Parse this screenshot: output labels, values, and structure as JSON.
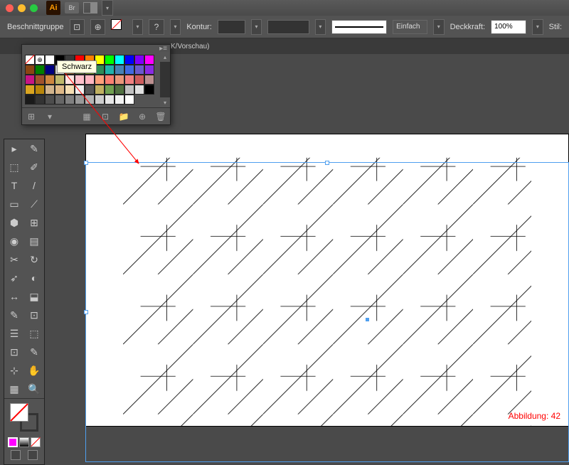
{
  "app": {
    "short": "Ai",
    "bridge": "Br"
  },
  "controlbar": {
    "object_type": "Beschnittgruppe",
    "stroke_label": "Kontur:",
    "stroke_style": "Einfach",
    "opacity_label": "Deckkraft:",
    "opacity_value": "100%",
    "style_label": "Stil:"
  },
  "tab": {
    "suffix": "K/Vorschau)"
  },
  "swatches": {
    "tooltip": "Schwarz",
    "rows": [
      [
        "#ffffff",
        "#000000",
        "#3a3a3a",
        "#ff0000",
        "#ff7f00",
        "#ffff00",
        "#00ff00",
        "#00ffff",
        "#0000ff",
        "#7f00ff",
        "#ff00ff",
        "#8b4513",
        "#008000",
        "#000080"
      ],
      [
        "#d0d0d0",
        "#8b5a2b",
        "#556b2f",
        "#6b8e23",
        "#2e8b57",
        "#20b2aa",
        "#4682b4",
        "#4169e1",
        "#6a5acd",
        "#8a2be2",
        "#c71585",
        "#a0522d",
        "#cd853f",
        "#bdb76b"
      ],
      [
        "#ffe4e1",
        "#ffc0cb",
        "#ffb6c1",
        "#ffa07a",
        "#fa8072",
        "#e9967a",
        "#f08080",
        "#cd5c5c",
        "#bc8f8f",
        "#daa520",
        "#b8860b",
        "#d2b48c",
        "#deb887",
        "#f5deb3"
      ],
      [
        "#eeeeee",
        "#555555",
        "#c0b060",
        "#70a050",
        "#507040",
        "#c0c0c0",
        "#e0e0e0"
      ],
      [
        "#000000",
        "#1a1a1a",
        "#333333",
        "#4d4d4d",
        "#666666",
        "#808080",
        "#999999",
        "#b3b3b3",
        "#cccccc",
        "#e6e6e6",
        "#f2f2f2",
        "#ffffff"
      ]
    ]
  },
  "caption": "Abbildung: 42",
  "tools": [
    [
      "▸",
      "✎"
    ],
    [
      "⬚",
      "✐"
    ],
    [
      "T",
      "/"
    ],
    [
      "▭",
      "⟋"
    ],
    [
      "⬢",
      "⊞"
    ],
    [
      "◉",
      "▤"
    ],
    [
      "✂",
      "↻"
    ],
    [
      "➶",
      "◐"
    ],
    [
      "↔",
      "⬓"
    ],
    [
      "✎",
      "⊡"
    ],
    [
      "☰",
      "⬚"
    ],
    [
      "⊡",
      "✎"
    ],
    [
      "⊹",
      "✋"
    ],
    [
      "▦",
      "🔍"
    ]
  ]
}
